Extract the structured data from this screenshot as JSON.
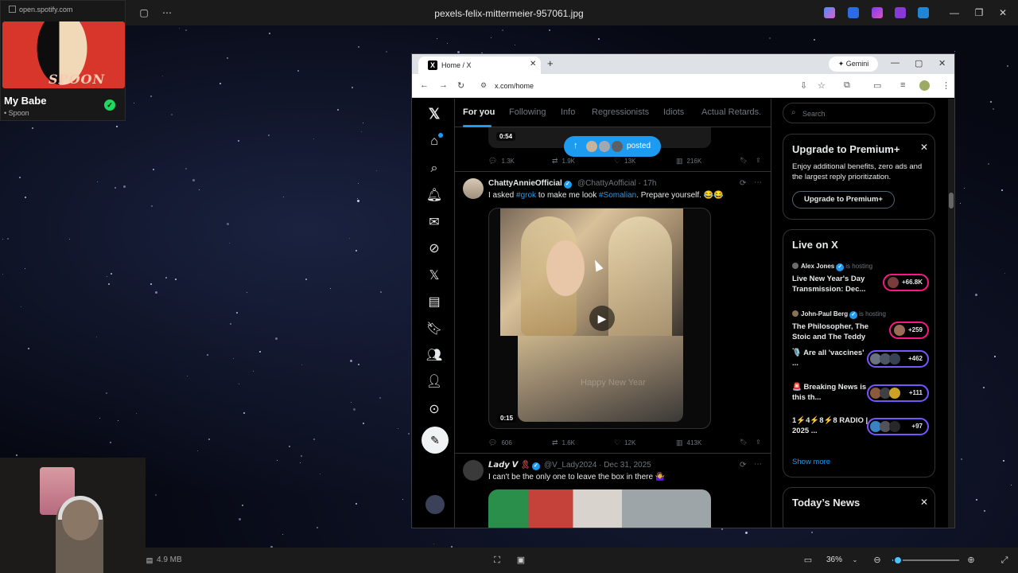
{
  "viewer": {
    "title": "pexels-felix-mittermeier-957061.jpg",
    "file_size": "4.9 MB",
    "zoom_level": "36%",
    "zoom_fraction": 0.12
  },
  "spotify": {
    "url": "open.spotify.com",
    "album_art_text": "SPOON",
    "track_title": "My Babe",
    "artist": "• Spoon"
  },
  "browser": {
    "tab_title": "Home / X",
    "gemini_label": "Gemini",
    "url": "x.com/home",
    "tab_icon": "X"
  },
  "x": {
    "tabs": [
      "For you",
      "Following",
      "Info",
      "Regressionists",
      "Idiots",
      "Actual Retards."
    ],
    "posted_pill": "posted",
    "prev_tweet": {
      "video_time": "0:54",
      "replies": "1.3K",
      "reposts": "1.9K",
      "likes": "13K",
      "views": "216K"
    },
    "tweet1": {
      "name": "ChattyAnnieOfficial",
      "handle_time": "@ChattyAofficial · 17h",
      "text_before": "I asked ",
      "hashtag1": "#grok",
      "text_middle": " to make me look ",
      "hashtag2": "#Somalian",
      "text_after": ". Prepare yourself. 😂😂",
      "video_time": "0:15",
      "video_overlay": "Happy New Year",
      "replies": "606",
      "reposts": "1.6K",
      "likes": "12K",
      "views": "413K"
    },
    "tweet2": {
      "name": "𝙇𝙖𝙙𝙮 𝙑",
      "handle_time": "@V_Lady2024 · Dec 31, 2025",
      "text": "I can't be the only one to leave the box in there 🤷‍♀️"
    },
    "sidebar": {
      "search_placeholder": "Search",
      "premium": {
        "title": "Upgrade to Premium+",
        "description": "Enjoy additional benefits, zero ads and the largest reply prioritization.",
        "button": "Upgrade to Premium+"
      },
      "live": {
        "title": "Live on X",
        "items": [
          {
            "host": "Alex Jones",
            "hosting": "is hosting",
            "title": "Live New Year's Day Transmission: Dec...",
            "count": "+66.8K",
            "ring": "#f91880"
          },
          {
            "host": "John-Paul Berg",
            "hosting": "is hosting",
            "title": "The Philosopher, The Stoic and The Teddy ...",
            "count": "+259",
            "ring": "#f91880"
          },
          {
            "host": "",
            "hosting": "",
            "title": "🎙️ Are all 'vaccines' ...",
            "count": "+462",
            "ring": "#7856ff"
          },
          {
            "host": "",
            "hosting": "",
            "title": "🚨 Breaking News is this th...",
            "count": "+111",
            "ring": "#7856ff"
          },
          {
            "host": "",
            "hosting": "",
            "title": "1⚡4⚡8⚡8 RADIO | 2025 ...",
            "count": "+97",
            "ring": "#7856ff"
          }
        ],
        "show_more": "Show more"
      },
      "news": {
        "title": "Today’s News"
      }
    }
  }
}
